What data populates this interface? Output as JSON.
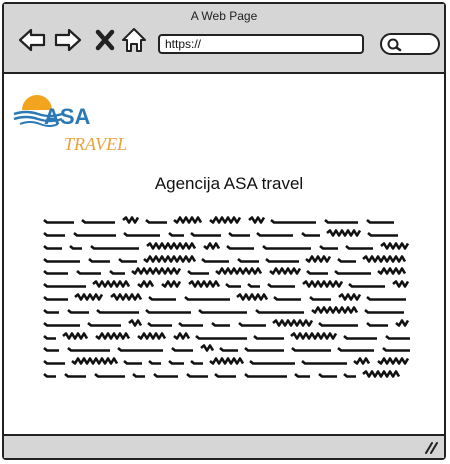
{
  "window": {
    "title": "A Web Page"
  },
  "toolbar": {
    "url": "https://",
    "icons": [
      "back-arrow-icon",
      "forward-arrow-icon",
      "close-x-icon",
      "home-icon",
      "search-icon"
    ]
  },
  "logo": {
    "line1": "ASA",
    "line2": "TRAVEL"
  },
  "main": {
    "heading": "Agencija ASA travel",
    "scribble_lines": 13
  },
  "colors": {
    "chrome": "#d6d6d6",
    "logo_blue": "#2a78b4",
    "logo_orange": "#e8a23a",
    "sun": "#f2a41e"
  }
}
